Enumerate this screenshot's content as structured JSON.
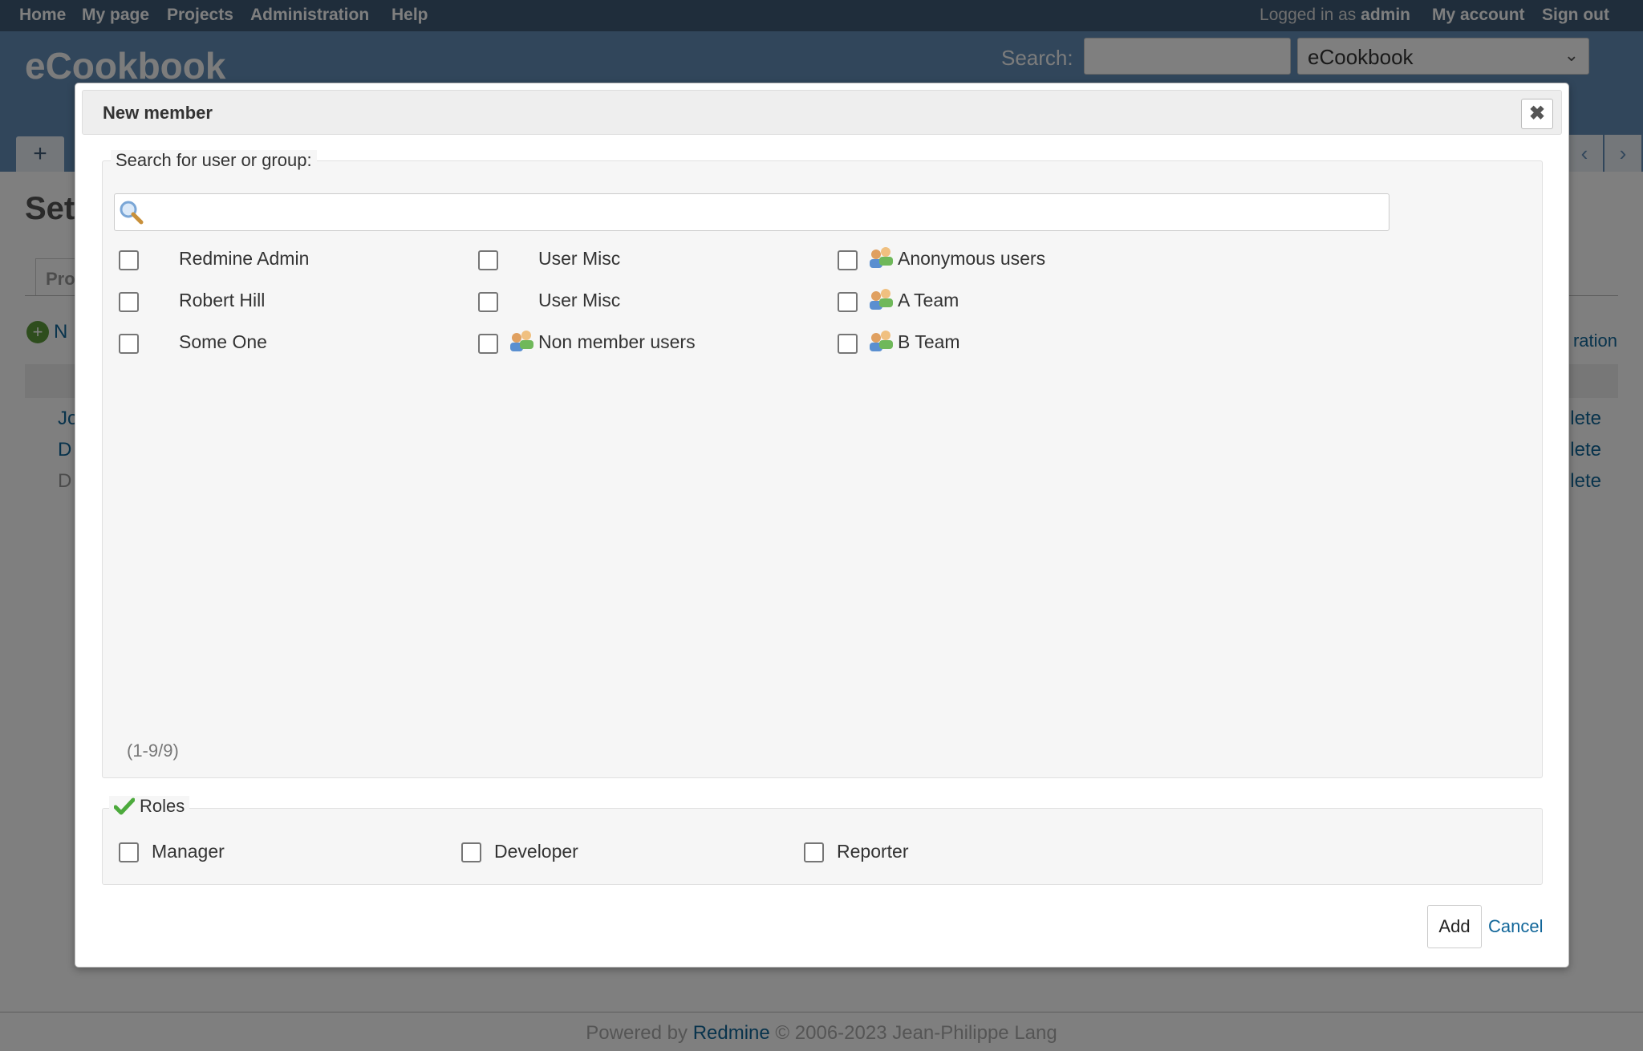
{
  "top_menu": {
    "items": [
      "Home",
      "My page",
      "Projects",
      "Administration",
      "Help"
    ],
    "logged_in_prefix": "Logged in as",
    "logged_in_user": "admin",
    "my_account": "My account",
    "sign_out": "Sign out"
  },
  "header": {
    "site_title": "eCookbook",
    "search_label": "Search:",
    "project_select_value": "eCookbook",
    "new_tab_symbol": "+"
  },
  "main": {
    "page_title_partial": "Set",
    "tab_partial": "Pro",
    "new_member_partial": "N",
    "configuration_partial": "ration",
    "row_links": [
      "Jo",
      "D",
      "D"
    ],
    "row_delete_partial": "lete"
  },
  "footer": {
    "powered_by": "Powered by",
    "redmine": "Redmine",
    "copyright": "© 2006-2023 Jean-Philippe Lang"
  },
  "dialog": {
    "title": "New member",
    "close_symbol": "✖",
    "search_legend": "Search for user or group:",
    "search_value": "",
    "principals": [
      {
        "name": "Redmine Admin",
        "group": false
      },
      {
        "name": "Robert Hill",
        "group": false
      },
      {
        "name": "Some One",
        "group": false
      },
      {
        "name": "User Misc",
        "group": false
      },
      {
        "name": "User Misc",
        "group": false
      },
      {
        "name": "Non member users",
        "group": true
      },
      {
        "name": "Anonymous users",
        "group": true
      },
      {
        "name": "A Team",
        "group": true
      },
      {
        "name": "B Team",
        "group": true
      }
    ],
    "count_text": "(1-9/9)",
    "roles_legend": "Roles",
    "roles": [
      "Manager",
      "Developer",
      "Reporter"
    ],
    "add_label": "Add",
    "cancel_label": "Cancel"
  },
  "colors": {
    "top_menu_bg": "#3e5b76",
    "header_bg": "#628db6",
    "link": "#116699",
    "fieldset_bg": "#f6f6f6"
  },
  "icons": {
    "search": "magnifier-icon",
    "group": "group-icon",
    "roles": "checkmark-icon",
    "close": "close-icon"
  }
}
